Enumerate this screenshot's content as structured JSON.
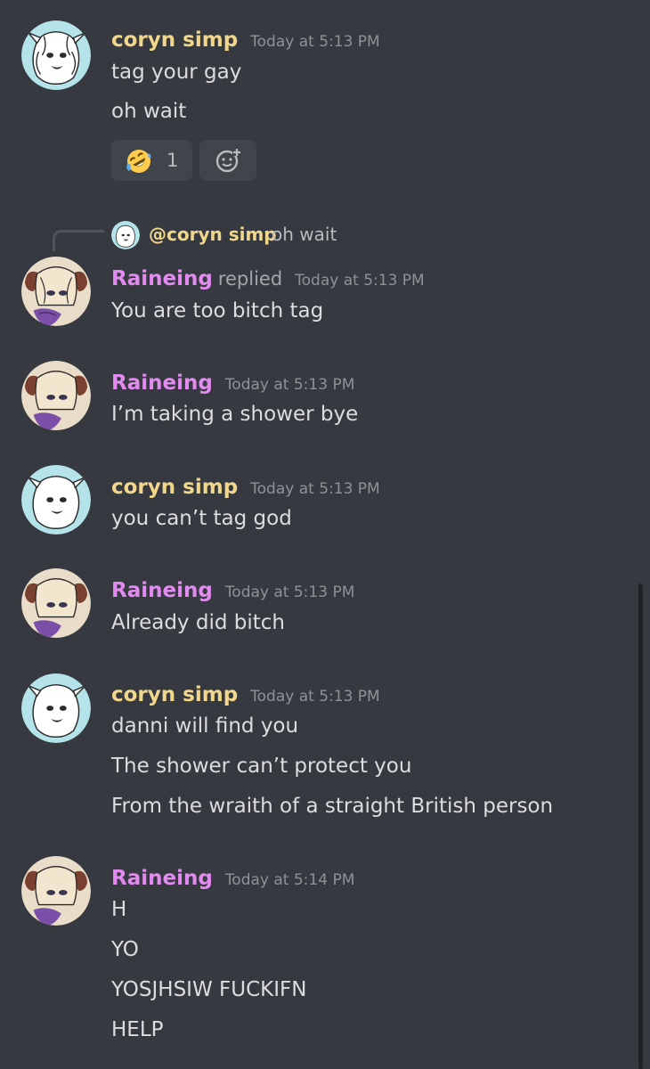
{
  "users": {
    "coryn": {
      "name": "coryn simp",
      "color": "#f1d78c"
    },
    "raine": {
      "name": "Raineing",
      "color": "#e28af0"
    }
  },
  "messages": [
    {
      "author": "coryn simp",
      "timestamp": "Today at 5:13 PM",
      "lines": [
        "tag your gay",
        "oh wait"
      ],
      "reactions": [
        {
          "emoji": "rolling-on-floor-laughing",
          "count": "1"
        }
      ],
      "add_reaction_icon": "add-reaction-icon"
    },
    {
      "author": "Raineing",
      "replied_label": "replied",
      "timestamp": "Today at 5:13 PM",
      "reply_to": {
        "mention": "@coryn simp",
        "text": "oh wait"
      },
      "lines": [
        "You are too bitch tag"
      ]
    },
    {
      "author": "Raineing",
      "timestamp": "Today at 5:13 PM",
      "lines": [
        "I’m taking a shower bye"
      ]
    },
    {
      "author": "coryn simp",
      "timestamp": "Today at 5:13 PM",
      "lines": [
        "you can’t tag god"
      ]
    },
    {
      "author": "Raineing",
      "timestamp": "Today at 5:13 PM",
      "lines": [
        "Already did bitch"
      ]
    },
    {
      "author": "coryn simp",
      "timestamp": "Today at 5:13 PM",
      "lines": [
        "danni will find you",
        "The shower can’t protect you",
        "From the wraith of a straight British person"
      ]
    },
    {
      "author": "Raineing",
      "timestamp": "Today at 5:14 PM",
      "lines": [
        "H",
        "YO",
        "YOSJHSIW FUCKIFN",
        "HELP"
      ]
    }
  ]
}
